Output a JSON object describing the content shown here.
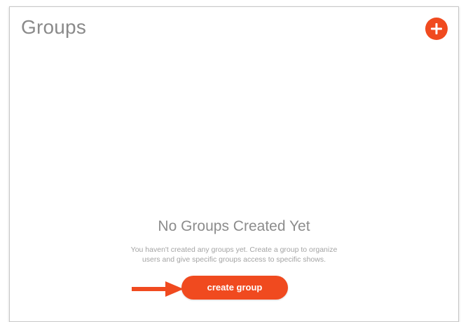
{
  "panel": {
    "title": "Groups",
    "add_icon": "plus-icon"
  },
  "empty_state": {
    "title": "No Groups Created Yet",
    "description": "You haven't created any groups yet. Create a group to organize users and give specific groups access to specific shows.",
    "button_label": "create group",
    "pointer_icon": "arrow-right-icon"
  },
  "colors": {
    "accent": "#f04a1f",
    "title_text": "#8a8a8a",
    "muted_text": "#a4a4a4",
    "border": "#c8c8c8"
  }
}
